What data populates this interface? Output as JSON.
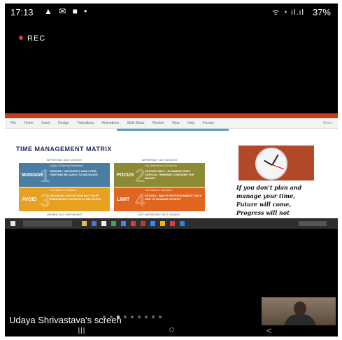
{
  "status_bar": {
    "time": "17:13",
    "left_icons": "▲ ✉ ■ •",
    "right_icons": "ᯤ ◔ ıl.ıl",
    "battery": "37%"
  },
  "recording": {
    "label": "REC"
  },
  "shared_screen": {
    "ribbon_tabs": [
      "File",
      "Home",
      "Insert",
      "Design",
      "Transitions",
      "Animations",
      "Slide Show",
      "Review",
      "View",
      "Help",
      "Format"
    ],
    "ribbon_right": "Share",
    "slide": {
      "title": "TIME MANAGEMENT MATRIX",
      "matrix": {
        "top_left_header": "IMPORTANT AND URGENT",
        "top_right_header": "IMPORTANT NOT URGENT",
        "bottom_left_footer": "URGENT NOT IMPORTANT",
        "bottom_right_footer": "NOT IMPORTANT, NOT URGENT",
        "quadrants": [
          {
            "number": "1",
            "label": "MANAGE",
            "sub": "Quality & Planning Preparation",
            "text": "DEMAND • NECESSITY DAILY FIRE-FIGHTING BE QUICK TO DELEGATE",
            "color": "#4a7da1"
          },
          {
            "number": "2",
            "label": "FOCUS",
            "sub": "Key Development & Planning",
            "text": "OPPORTUNITY • PLANNING KEEP CRITICAL THINKING CONSIDER THE MACRO",
            "color": "#8d8a36"
          },
          {
            "number": "3",
            "label": "AVOID",
            "sub": "Time Waste & Distraction",
            "text": "DELUSION • DECEPTION NOT YOUR EMERGENCY CAREFULLY DELEGATE",
            "color": "#e8a021"
          },
          {
            "number": "4",
            "label": "LIMIT",
            "sub": "Time Waste & Distraction",
            "text": "EXCESS • WASTE ENTERTAINMENT ONLY USE TO MINIMIZE STRESS",
            "color": "#e0651f"
          }
        ]
      },
      "quote": [
        "If you don't plan and",
        "manage your time,",
        "Future will come,",
        "Progress will not"
      ]
    }
  },
  "presenter": {
    "label": "Udaya Shrivastava's screen"
  },
  "pagination": {
    "count": 9,
    "active_index": 2
  },
  "nav_bar": {
    "recents": "III",
    "home": "○",
    "back": "<"
  },
  "colors": {
    "rec_dot": "#e53935",
    "ppt_accent": "#c43e1c",
    "slide_title": "#1f2a5a",
    "clock_bg": "#b24a2a"
  }
}
